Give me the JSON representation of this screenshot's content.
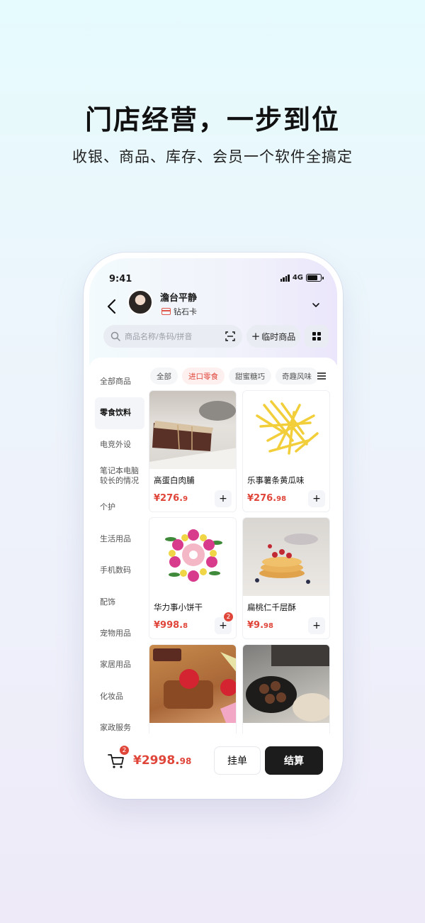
{
  "hero": {
    "title": "门店经营，一步到位",
    "subtitle": "收银、商品、库存、会员一个软件全搞定"
  },
  "status": {
    "time": "9:41",
    "network": "4G",
    "battery_level": 0.8
  },
  "member": {
    "name": "澹台平静",
    "level": "钻石卡"
  },
  "search": {
    "placeholder": "商品名称/条码/拼音"
  },
  "toolbar": {
    "temp_goods_label": "临时商品"
  },
  "sidebar": {
    "items": [
      {
        "label": "全部商品",
        "active": false
      },
      {
        "label": "零食饮料",
        "active": true
      },
      {
        "label": "电竞外设",
        "active": false
      },
      {
        "label": "笔记本电脑较长的情况",
        "active": false
      },
      {
        "label": "个护",
        "active": false
      },
      {
        "label": "生活用品",
        "active": false
      },
      {
        "label": "手机数码",
        "active": false
      },
      {
        "label": "配饰",
        "active": false
      },
      {
        "label": "宠物用品",
        "active": false
      },
      {
        "label": "家居用品",
        "active": false
      },
      {
        "label": "化妆品",
        "active": false
      },
      {
        "label": "家政服务",
        "active": false
      }
    ]
  },
  "tabs": [
    {
      "label": "全部",
      "active": false
    },
    {
      "label": "进口零食",
      "active": true
    },
    {
      "label": "甜蜜糖巧",
      "active": false
    },
    {
      "label": "奇趣风味",
      "active": false
    }
  ],
  "products": [
    {
      "name": "高蛋白肉脯",
      "price_main": "¥276.",
      "price_dec": "9",
      "image": "brownie",
      "cart_count": ""
    },
    {
      "name": "乐事薯条黄瓜味",
      "price_main": "¥276.",
      "price_dec": "98",
      "image": "fries",
      "cart_count": ""
    },
    {
      "name": "华力事小饼干",
      "price_main": "¥998.",
      "price_dec": "8",
      "image": "flower-donut",
      "cart_count": "2"
    },
    {
      "name": "扁桃仁千层酥",
      "price_main": "¥9.",
      "price_dec": "98",
      "image": "pancake",
      "cart_count": ""
    },
    {
      "name": "",
      "price_main": "",
      "price_dec": "",
      "image": "apple",
      "cart_count": ""
    },
    {
      "name": "",
      "price_main": "",
      "price_dec": "",
      "image": "cookie",
      "cart_count": ""
    }
  ],
  "cart": {
    "count": "2",
    "total_main": "¥2998.",
    "total_dec": "98",
    "hold_label": "挂单",
    "checkout_label": "结算"
  },
  "colors": {
    "accent": "#e0453a",
    "dark": "#1c1c1c"
  }
}
